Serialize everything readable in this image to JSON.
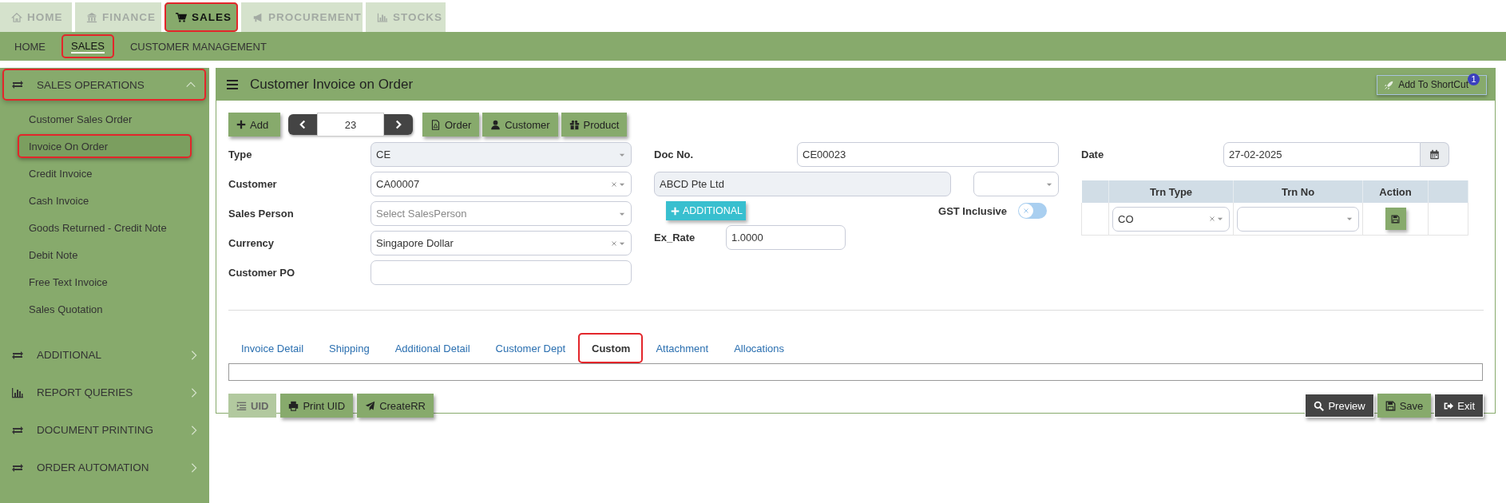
{
  "top_tabs": [
    {
      "label": "HOME",
      "selected": false,
      "highlighted": false
    },
    {
      "label": "FINANCE",
      "selected": false,
      "highlighted": false
    },
    {
      "label": "SALES",
      "selected": true,
      "highlighted": true
    },
    {
      "label": "PROCUREMENT",
      "selected": false,
      "highlighted": false
    },
    {
      "label": "STOCKS",
      "selected": false,
      "highlighted": false
    }
  ],
  "sub_nav": [
    {
      "label": "HOME",
      "selected": false,
      "highlighted": false
    },
    {
      "label": "SALES",
      "selected": true,
      "highlighted": true
    },
    {
      "label": "CUSTOMER MANAGEMENT",
      "selected": false,
      "highlighted": false
    }
  ],
  "sidebar": [
    {
      "label": "SALES OPERATIONS",
      "expanded": true,
      "highlighted": true,
      "children": [
        {
          "label": "Customer Sales Order",
          "selected": false,
          "highlighted": false
        },
        {
          "label": "Invoice On Order",
          "selected": true,
          "highlighted": true
        },
        {
          "label": "Credit Invoice",
          "selected": false,
          "highlighted": false
        },
        {
          "label": "Cash Invoice",
          "selected": false,
          "highlighted": false
        },
        {
          "label": "Goods Returned - Credit Note",
          "selected": false,
          "highlighted": false
        },
        {
          "label": "Debit Note",
          "selected": false,
          "highlighted": false
        },
        {
          "label": "Free Text Invoice",
          "selected": false,
          "highlighted": false
        },
        {
          "label": "Sales Quotation",
          "selected": false,
          "highlighted": false
        }
      ]
    },
    {
      "label": "ADDITIONAL",
      "expanded": false,
      "highlighted": false
    },
    {
      "label": "REPORT QUERIES",
      "expanded": false,
      "highlighted": false
    },
    {
      "label": "DOCUMENT PRINTING",
      "expanded": false,
      "highlighted": false
    },
    {
      "label": "ORDER AUTOMATION",
      "expanded": false,
      "highlighted": false
    }
  ],
  "panel": {
    "title": "Customer Invoice on Order",
    "shortcut": {
      "label": "Add To ShortCut",
      "badge": "1"
    },
    "toolbar": {
      "add": "Add",
      "record": "23",
      "links": [
        "Order",
        "Customer",
        "Product"
      ]
    },
    "fields_left": [
      {
        "label": "Type",
        "kind": "select",
        "value": "CE",
        "disabled": true
      },
      {
        "label": "Customer",
        "kind": "select",
        "value": "CA00007",
        "disabled": false
      },
      {
        "label": "Sales Person",
        "kind": "select",
        "placeholder": "Select SalesPerson",
        "disabled": false
      },
      {
        "label": "Currency",
        "kind": "select",
        "value": "Singapore Dollar",
        "disabled": false
      },
      {
        "label": "Customer PO",
        "kind": "text",
        "disabled": false
      }
    ],
    "doc_no": {
      "label": "Doc No.",
      "value": "CE00023"
    },
    "customer_name": {
      "value": "ABCD Pte Ltd",
      "disabled": true
    },
    "additional_button": "ADDITIONAL",
    "gst": {
      "label": "GST Inclusive",
      "on": false
    },
    "ex_rate": {
      "label": "Ex_Rate",
      "value": "1.0000"
    },
    "date": {
      "label": "Date",
      "value": "27-02-2025"
    },
    "trn_table": {
      "columns": [
        "Trn Type",
        "Trn No",
        "Action"
      ],
      "rows": [
        {
          "trn_type": "CO"
        }
      ]
    },
    "tabs": [
      {
        "label": "Invoice Detail",
        "selected": false,
        "highlighted": false
      },
      {
        "label": "Shipping",
        "selected": false,
        "highlighted": false
      },
      {
        "label": "Additional Detail",
        "selected": false,
        "highlighted": false
      },
      {
        "label": "Customer Dept",
        "selected": false,
        "highlighted": false
      },
      {
        "label": "Custom",
        "selected": true,
        "highlighted": true
      },
      {
        "label": "Attachment",
        "selected": false,
        "highlighted": false
      },
      {
        "label": "Allocations",
        "selected": false,
        "highlighted": false
      }
    ],
    "actions_left": [
      {
        "label": "UID",
        "disabled": true
      },
      {
        "label": "Print UID",
        "disabled": false
      },
      {
        "label": "CreateRR",
        "disabled": false
      }
    ],
    "actions_right": [
      {
        "label": "Preview",
        "kind": "dark"
      },
      {
        "label": "Save",
        "kind": "green"
      },
      {
        "label": "Exit",
        "kind": "dark"
      }
    ]
  }
}
